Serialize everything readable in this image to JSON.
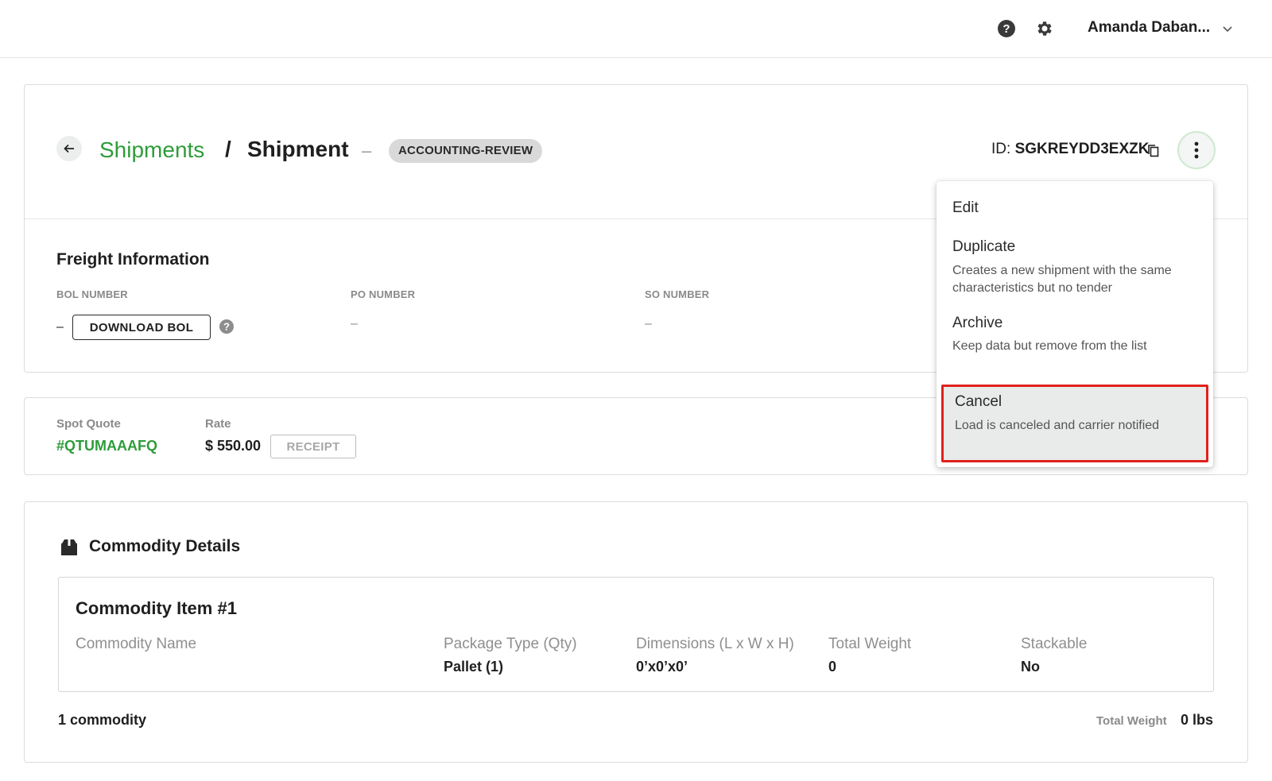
{
  "header": {
    "user_name": "Amanda Daban..."
  },
  "page": {
    "breadcrumb_parent": "Shipments",
    "breadcrumb_separator": "/",
    "breadcrumb_current": "Shipment",
    "title_dash": "–",
    "status": "ACCOUNTING-REVIEW",
    "id_prefix": "ID:",
    "id_value": "SGKREYDD3EXZK"
  },
  "freight": {
    "title": "Freight Information",
    "bol_label": "BOL NUMBER",
    "bol_value": "–",
    "download_bol": "DOWNLOAD BOL",
    "po_label": "PO NUMBER",
    "po_value": "–",
    "so_label": "SO NUMBER",
    "so_value": "–"
  },
  "quote": {
    "spot_quote_label": "Spot Quote",
    "spot_quote_value": "#QTUMAAAFQ",
    "rate_label": "Rate",
    "rate_value": "$ 550.00",
    "receipt": "RECEIPT"
  },
  "commodity": {
    "title": "Commodity Details",
    "item_title": "Commodity Item #1",
    "columns": [
      {
        "head": "Commodity Name",
        "value": ""
      },
      {
        "head": "Package Type (Qty)",
        "value": "Pallet (1)"
      },
      {
        "head": "Dimensions (L x W x H)",
        "value": "0’x0’x0’"
      },
      {
        "head": "Total Weight",
        "value": "0"
      },
      {
        "head": "Stackable",
        "value": "No"
      }
    ],
    "count": "1 commodity",
    "total_weight_label": "Total Weight",
    "total_weight_value": "0 lbs"
  },
  "menu": {
    "items": [
      {
        "label": "Edit",
        "desc": ""
      },
      {
        "label": "Duplicate",
        "desc": "Creates a new shipment with the same characteristics but no tender"
      },
      {
        "label": "Archive",
        "desc": "Keep data but remove from the list"
      },
      {
        "label": "Cancel",
        "desc": "Load is canceled and carrier notified"
      }
    ],
    "highlight_color": "#e0211c"
  },
  "colors": {
    "accent_green": "#2e9c3a",
    "badge_bg": "#d9d9d9"
  }
}
